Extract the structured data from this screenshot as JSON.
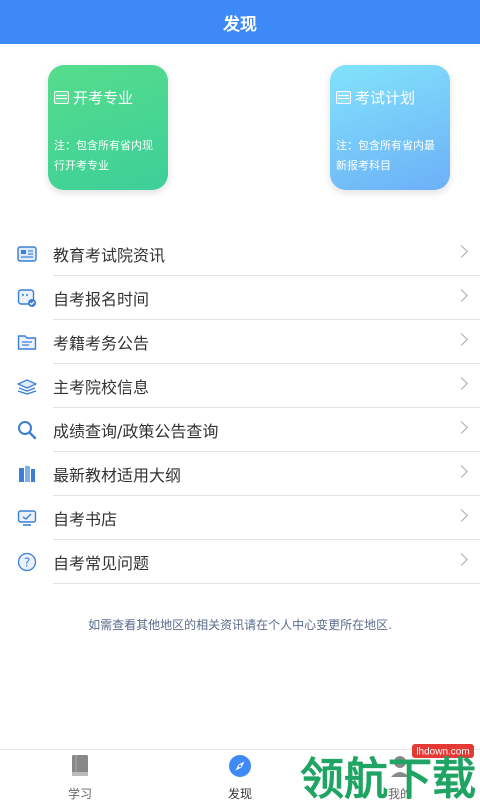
{
  "header": {
    "title": "发现"
  },
  "cards": [
    {
      "title": "开考专业",
      "note": "注：包含所有省内现行开考专业",
      "icon": "book-grid-icon"
    },
    {
      "title": "考试计划",
      "note": "注：包含所有省内最新报考科目",
      "icon": "book-grid-icon"
    }
  ],
  "menu": [
    {
      "label": "教育考试院资讯",
      "icon": "newspaper-icon"
    },
    {
      "label": "自考报名时间",
      "icon": "calendar-check-icon"
    },
    {
      "label": "考籍考务公告",
      "icon": "folder-doc-icon"
    },
    {
      "label": "主考院校信息",
      "icon": "graduation-cap-icon"
    },
    {
      "label": "成绩查询/政策公告查询",
      "icon": "search-icon"
    },
    {
      "label": "最新教材适用大纲",
      "icon": "books-icon"
    },
    {
      "label": "自考书店",
      "icon": "monitor-store-icon"
    },
    {
      "label": "自考常见问题",
      "icon": "help-icon"
    }
  ],
  "hint": "如需查看其他地区的相关资讯请在个人中心变更所在地区.",
  "tabs": [
    {
      "label": "学习",
      "icon": "book-icon",
      "active": false
    },
    {
      "label": "发现",
      "icon": "compass-icon",
      "active": true
    },
    {
      "label": "我的",
      "icon": "user-icon",
      "active": false
    }
  ],
  "watermark": {
    "text": "领航下载",
    "url": "lhdown.com"
  },
  "colors": {
    "accent": "#3d8af7",
    "card_green": "#49d690",
    "card_blue": "#78c7f9",
    "icon_blue": "#3b7fd6"
  }
}
